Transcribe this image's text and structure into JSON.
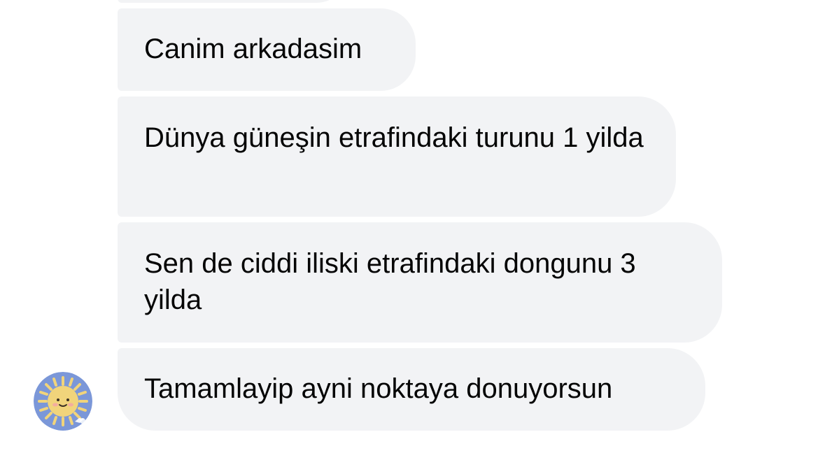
{
  "messages": [
    {
      "text": "Canim arkadasim"
    },
    {
      "text": "Dünya güneşin etrafindaki turunu 1 yilda"
    },
    {
      "text": "Sen de ciddi iliski etrafindaki dongunu 3 yilda"
    },
    {
      "text": "Tamamlayip ayni noktaya donuyorsun"
    }
  ],
  "colors": {
    "bubble_bg": "#f2f3f5",
    "text": "#050505",
    "avatar_bg": "#7b97d8",
    "sun": "#f1d47b"
  },
  "avatar": {
    "icon": "sun-face-icon"
  }
}
